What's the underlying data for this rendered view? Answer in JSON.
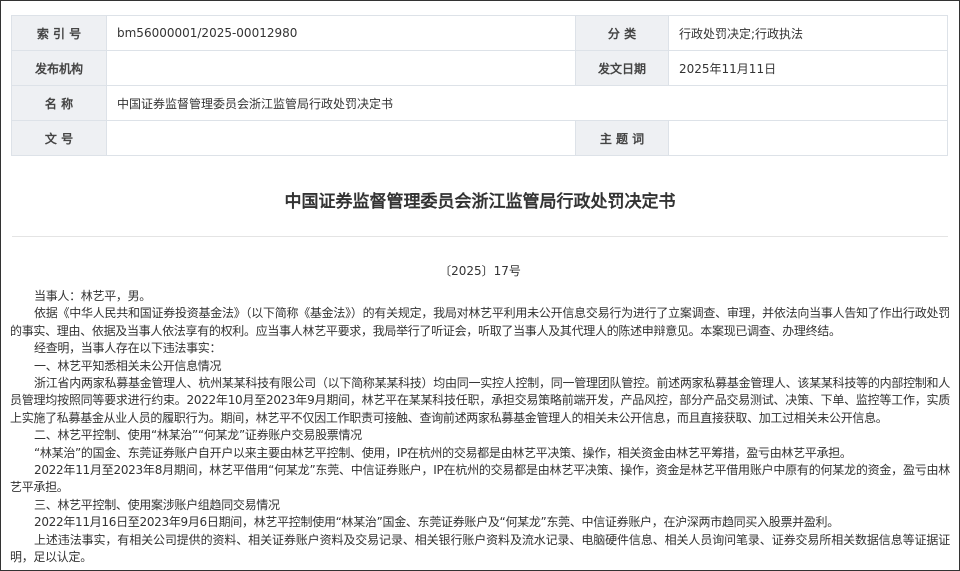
{
  "meta": {
    "index_label": "索 引 号",
    "index_value": "bm56000001/2025-00012980",
    "category_label": "分 类",
    "category_value": "行政处罚决定;行政执法",
    "issuer_label": "发布机构",
    "issuer_value": "",
    "date_label": "发文日期",
    "date_value": "2025年11月11日",
    "name_label": "名 称",
    "name_value": "中国证券监督管理委员会浙江监管局行政处罚决定书",
    "docnum_label": "文 号",
    "docnum_value": "",
    "subject_label": "主 题 词",
    "subject_value": ""
  },
  "document": {
    "title": "中国证券监督管理委员会浙江监管局行政处罚决定书",
    "number": "〔2025〕17号",
    "paragraphs": [
      "当事人：林艺平，男。",
      "依据《中华人民共和国证券投资基金法》（以下简称《基金法》）的有关规定，我局对林艺平利用未公开信息交易行为进行了立案调查、审理，并依法向当事人告知了作出行政处罚的事实、理由、依据及当事人依法享有的权利。应当事人林艺平要求，我局举行了听证会，听取了当事人及其代理人的陈述申辩意见。本案现已调查、办理终结。",
      "经查明，当事人存在以下违法事实：",
      "一、林艺平知悉相关未公开信息情况",
      "浙江省内两家私募基金管理人、杭州某某科技有限公司（以下简称某某科技）均由同一实控人控制，同一管理团队管控。前述两家私募基金管理人、该某某科技等的内部控制和人员管理均按照同等要求进行约束。2022年10月至2023年9月期间，林艺平在某某科技任职，承担交易策略前端开发，产品风控，部分产品交易测试、决策、下单、监控等工作，实质上实施了私募基金从业人员的履职行为。期间，林艺平不仅因工作职责可接触、查询前述两家私募基金管理人的相关未公开信息，而且直接获取、加工过相关未公开信息。",
      "二、林艺平控制、使用“林某治”“何某龙”证券账户交易股票情况",
      "“林某治”的国金、东莞证券账户自开户以来主要由林艺平控制、使用，IP在杭州的交易都是由林艺平决策、操作，相关资金由林艺平筹措，盈亏由林艺平承担。",
      "2022年11月至2023年8月期间，林艺平借用“何某龙”东莞、中信证券账户，IP在杭州的交易都是由林艺平决策、操作，资金是林艺平借用账户中原有的何某龙的资金，盈亏由林艺平承担。",
      "三、林艺平控制、使用案涉账户组趋同交易情况",
      "2022年11月16日至2023年9月6日期间，林艺平控制使用“林某治”国金、东莞证券账户及“何某龙”东莞、中信证券账户，在沪深两市趋同买入股票并盈利。",
      "上述违法事实，有相关公司提供的资料、相关证券账户资料及交易记录、相关银行账户资料及流水记录、电脑硬件信息、相关人员询问笔录、证券交易所相关数据信息等证据证明，足以认定。"
    ]
  }
}
